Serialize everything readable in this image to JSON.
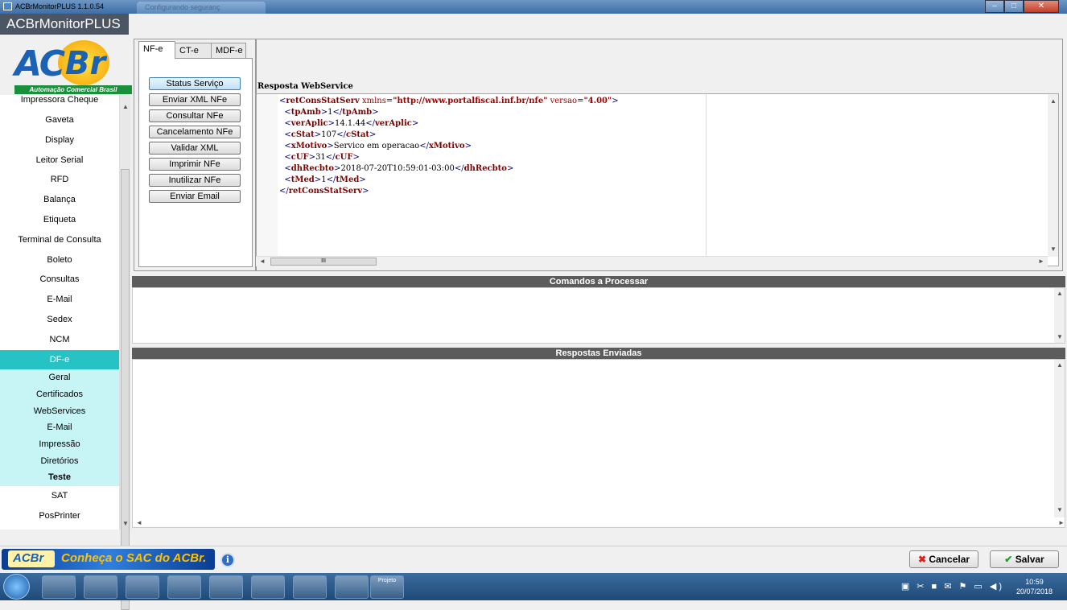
{
  "window": {
    "title": "ACBrMonitorPLUS 1.1.0.54",
    "second_tab": "Configurando seguranç"
  },
  "app": {
    "title": "ACBrMonitorPLUS",
    "slogan": "Automação Comercial Brasil"
  },
  "sidebar": {
    "items": [
      "Impressora Cheque",
      "Gaveta",
      "Display",
      "Leitor Serial",
      "RFD",
      "Balança",
      "Etiqueta",
      "Terminal de Consulta",
      "Boleto",
      "Consultas",
      "E-Mail",
      "Sedex",
      "NCM"
    ],
    "active": "DF-e",
    "subitems": [
      "Geral",
      "Certificados",
      "WebServices",
      "E-Mail",
      "Impressão",
      "Diretórios"
    ],
    "selected_sub": "Teste",
    "after": [
      "SAT",
      "PosPrinter"
    ]
  },
  "tabs": {
    "nfe": "NF-e",
    "cte": "CT-e",
    "mdfe": "MDF-e"
  },
  "buttons": {
    "status": "Status Serviço",
    "enviar_xml": "Enviar XML NFe",
    "consultar": "Consultar NFe",
    "cancelamento": "Cancelamento NFe",
    "validar": "Validar XML",
    "imprimir": "Imprimir NFe",
    "inutilizar": "Inutilizar NFe",
    "enviar_email": "Enviar Email"
  },
  "response": {
    "label": "Resposta WebService",
    "root_tag": "retConsStatServ",
    "xmlns": "http://www.portalfiscal.inf.br/nfe",
    "versao": "4.00",
    "fields": [
      {
        "tag": "tpAmb",
        "value": "1"
      },
      {
        "tag": "verAplic",
        "value": "14.1.44"
      },
      {
        "tag": "cStat",
        "value": "107"
      },
      {
        "tag": "xMotivo",
        "value": "Servico em operacao"
      },
      {
        "tag": "cUF",
        "value": "31"
      },
      {
        "tag": "dhRecbto",
        "value": "2018-07-20T10:59:01-03:00"
      },
      {
        "tag": "tMed",
        "value": "1"
      }
    ]
  },
  "sections": {
    "comandos": "Comandos a Processar",
    "respostas": "Respostas Enviadas"
  },
  "footer": {
    "sac": "Conheça o SAC do ACBr.",
    "cancel": "Cancelar",
    "save": "Salvar"
  },
  "taskbar": {
    "clock_time": "10:59",
    "clock_date": "20/07/2018",
    "app_label": "Projeto"
  }
}
